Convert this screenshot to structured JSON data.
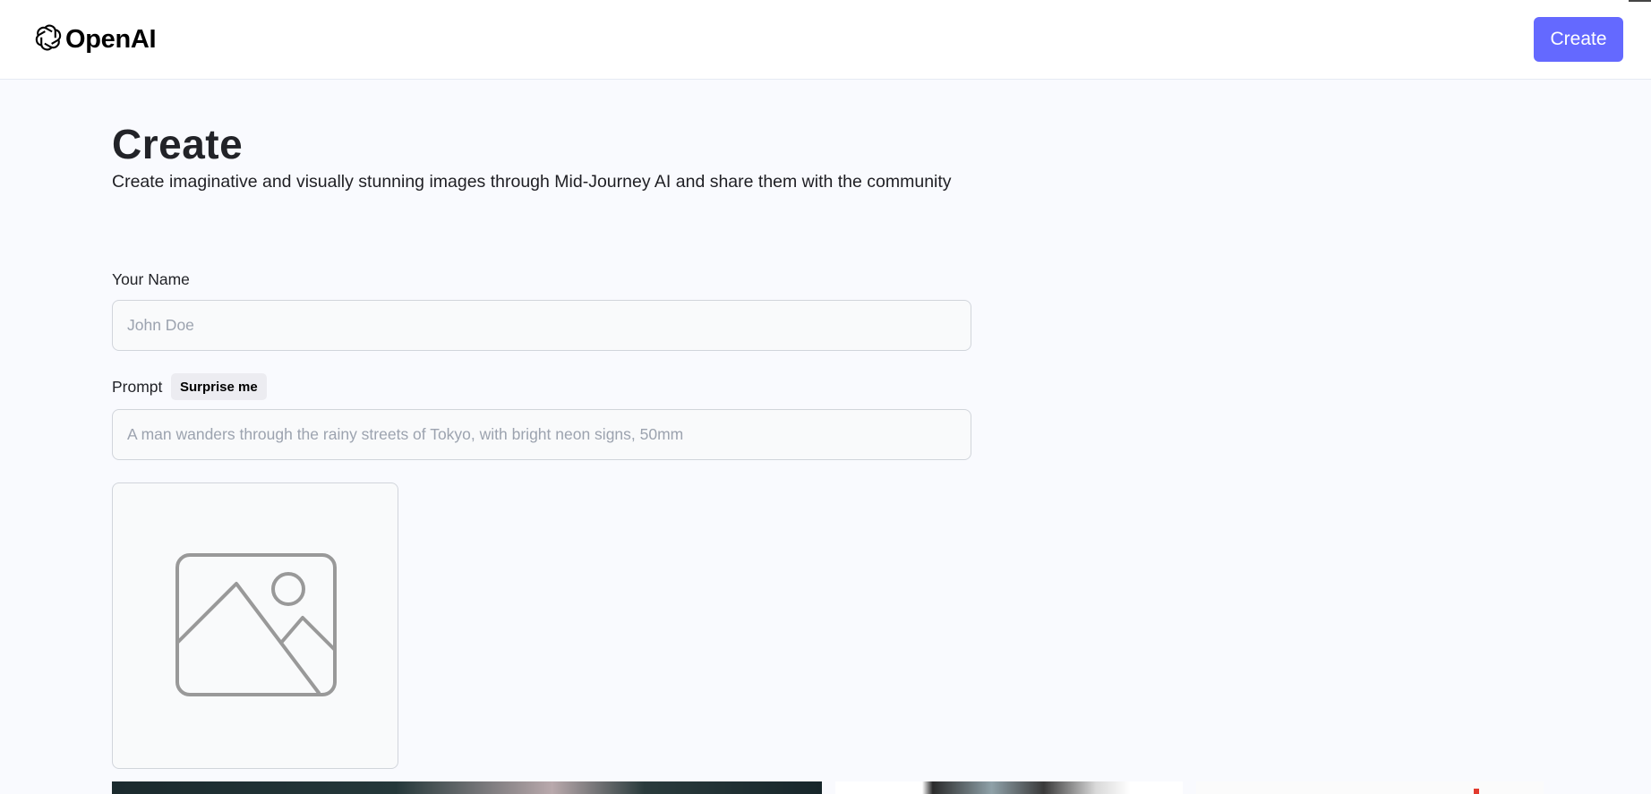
{
  "header": {
    "logo_text": "OpenAI",
    "create_button": "Create"
  },
  "main": {
    "title": "Create",
    "subtitle": "Create imaginative and visually stunning images through Mid-Journey AI and share them with the community"
  },
  "form": {
    "name_label": "Your Name",
    "name_placeholder": "John Doe",
    "name_value": "",
    "prompt_label": "Prompt",
    "surprise_button": "Surprise me",
    "prompt_placeholder": "A man wanders through the rainy streets of Tokyo, with bright neon signs, 50mm",
    "prompt_value": ""
  },
  "icons": {
    "logo": "openai-logo-icon",
    "preview": "image-placeholder-icon"
  },
  "colors": {
    "accent": "#6469ff",
    "background": "#f9fafe",
    "title": "#222328"
  }
}
